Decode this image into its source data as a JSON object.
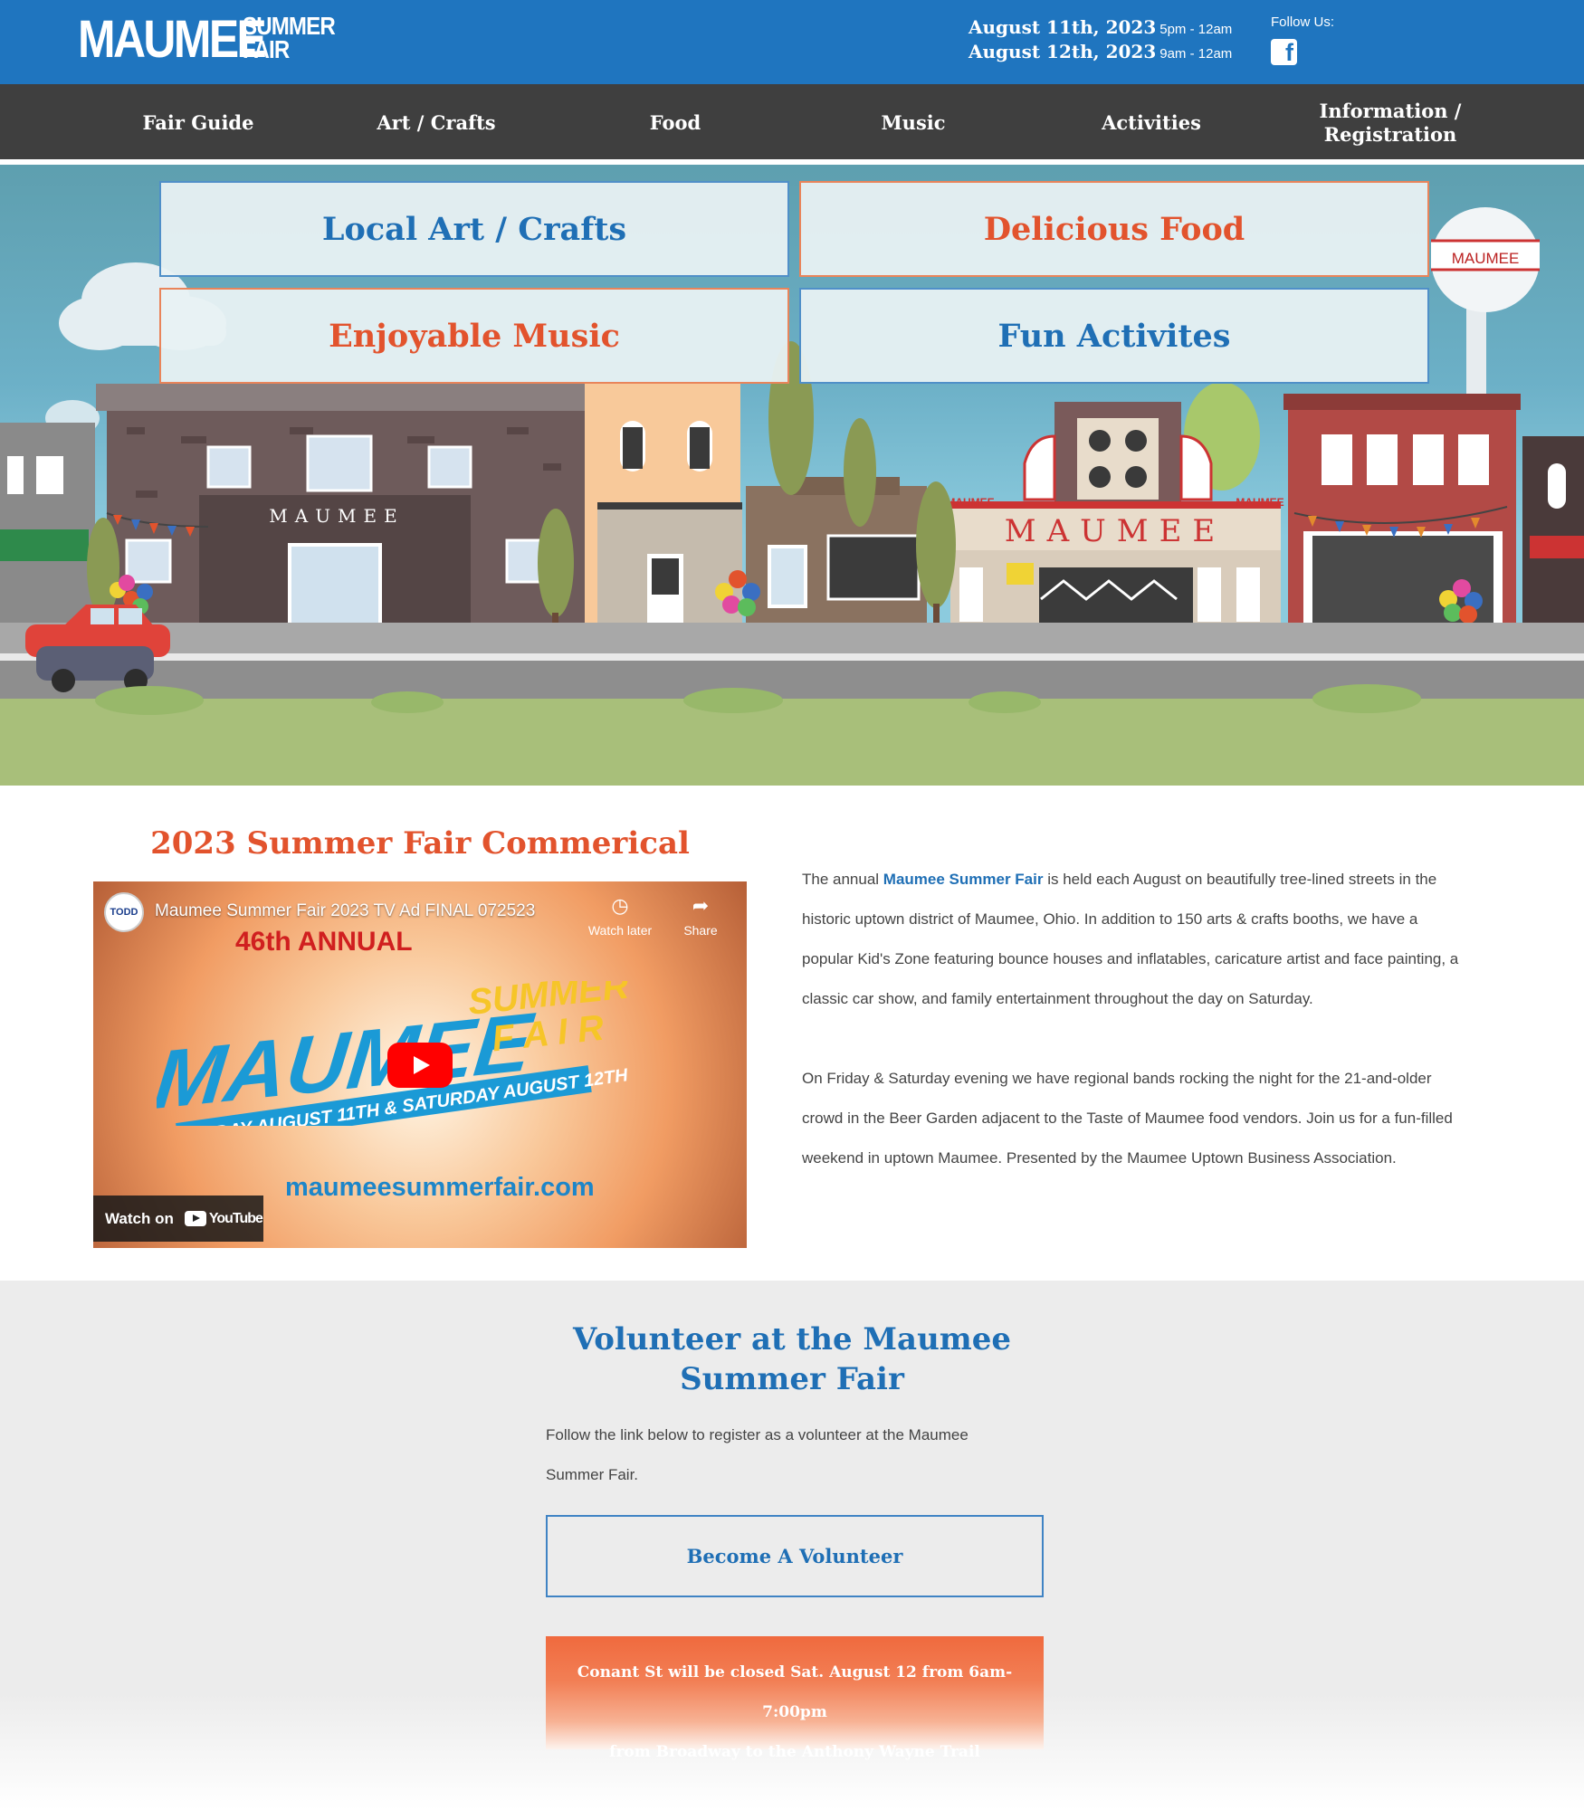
{
  "header": {
    "logo_main": "MAUMEE",
    "logo_sub1": "SUMMER",
    "logo_sub2": "FAIR",
    "dates": [
      {
        "date": "August 11th, 2023",
        "time": "5pm - 12am"
      },
      {
        "date": "August 12th, 2023",
        "time": "9am - 12am"
      }
    ],
    "follow_label": "Follow Us:",
    "facebook_glyph": "f"
  },
  "nav": {
    "items": [
      "Fair Guide",
      "Art / Crafts",
      "Food",
      "Music",
      "Activities",
      "Information / Registration"
    ]
  },
  "hero": {
    "tiles": [
      "Local Art / Crafts",
      "Delicious Food",
      "Enjoyable Music",
      "Fun Activites"
    ],
    "building_sign": "MAUMEE",
    "theater_sign": "MAUMEE",
    "marquee_small": "MAUMEE",
    "water_tower": "MAUMEE"
  },
  "commercial": {
    "title": "2023 Summer Fair Commerical",
    "video_title": "Maumee Summer Fair 2023 TV Ad FINAL 072523",
    "channel_badge": "TODD",
    "watch_later": "Watch later",
    "share": "Share",
    "annual": "46th ANNUAL",
    "logo_maumee": "MAUMEE",
    "logo_summer": "SUMMER",
    "logo_fair": "F A I R",
    "banner": "FRIDAY AUGUST 11TH & SATURDAY AUGUST 12TH",
    "url": "maumeesummerfair.com",
    "watch_on": "Watch on",
    "youtube": "YouTube"
  },
  "about": {
    "p1_pre": "The annual ",
    "p1_link": "Maumee Summer Fair",
    "p1_post": " is held each August on beautifully tree-lined streets in the historic uptown district of Maumee, Ohio. In addition to 150 arts & crafts booths, we have a popular Kid's Zone featuring bounce houses and inflatables, caricature artist and face painting, a classic car show, and family entertainment throughout the day on Saturday.",
    "p2": "On Friday & Saturday evening we have regional bands rocking the night for the 21-and-older crowd in the Beer Garden adjacent to the Taste of Maumee food vendors. Join us for a fun-filled weekend in uptown Maumee. Presented by the Maumee Uptown Business Association."
  },
  "volunteer": {
    "title": "Volunteer at the Maumee Summer Fair",
    "text": "Follow the link below to register as a volunteer at the Maumee Summer Fair.",
    "button": "Become A Volunteer",
    "notice_line1": "Conant St will be closed Sat. August 12 from 6am-7:00pm",
    "notice_line2": "from Broadway to the Anthony Wayne Trail"
  },
  "colors": {
    "brand_blue": "#1f75bf",
    "nav_dark": "#3f3f3f",
    "accent_orange": "#e2532d",
    "link_blue": "#1f6fb5"
  }
}
